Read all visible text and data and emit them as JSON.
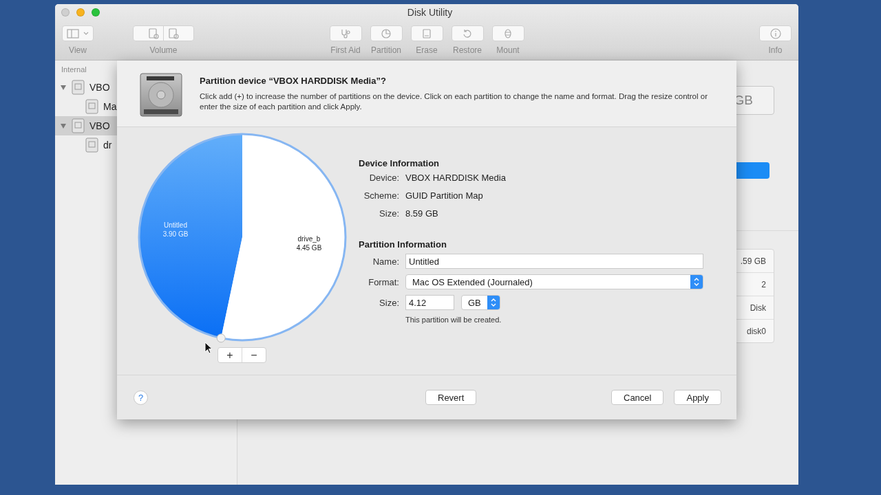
{
  "window": {
    "title": "Disk Utility"
  },
  "toolbar": [
    {
      "label": "View",
      "kind": "view"
    },
    {
      "label": "Volume",
      "kind": "volume"
    },
    {
      "label": "First Aid",
      "kind": "firstaid"
    },
    {
      "label": "Partition",
      "kind": "partition"
    },
    {
      "label": "Erase",
      "kind": "erase"
    },
    {
      "label": "Restore",
      "kind": "restore"
    },
    {
      "label": "Mount",
      "kind": "mount"
    },
    {
      "label": "Info",
      "kind": "info"
    }
  ],
  "sidebar": {
    "section": "Internal",
    "items": [
      {
        "label": "VBO",
        "selected": false,
        "expanded": true,
        "children": [
          {
            "label": "Ma",
            "selected": false
          }
        ]
      },
      {
        "label": "VBO",
        "selected": true,
        "expanded": true,
        "children": [
          {
            "label": "dr",
            "selected": false
          }
        ]
      }
    ]
  },
  "detail": {
    "capacity": "GB",
    "info_values": [
      ".59 GB",
      "2",
      "Disk",
      "disk0"
    ]
  },
  "sheet": {
    "title": "Partition device “VBOX HARDDISK Media”?",
    "description": "Click add (+) to increase the number of partitions on the device. Click on each partition to change the name and format. Drag the resize control or enter the size of each partition and click Apply.",
    "chart_data": {
      "type": "pie",
      "categories": [
        "Untitled",
        "drive_b"
      ],
      "values": [
        3.9,
        4.45
      ],
      "value_labels": [
        "3.90 GB",
        "4.45 GB"
      ]
    },
    "add_button": "+",
    "remove_button": "−",
    "device_info": {
      "heading": "Device Information",
      "rows": [
        {
          "label": "Device:",
          "value": "VBOX HARDDISK Media"
        },
        {
          "label": "Scheme:",
          "value": "GUID Partition Map"
        },
        {
          "label": "Size:",
          "value": "8.59 GB"
        }
      ]
    },
    "partition_info": {
      "heading": "Partition Information",
      "name": {
        "label": "Name:",
        "value": "Untitled"
      },
      "format": {
        "label": "Format:",
        "value": "Mac OS Extended (Journaled)"
      },
      "size": {
        "label": "Size:",
        "value": "4.12",
        "unit": "GB"
      },
      "note": "This partition will be created."
    },
    "help": "?",
    "buttons": [
      "Revert",
      "Cancel",
      "Apply"
    ]
  }
}
